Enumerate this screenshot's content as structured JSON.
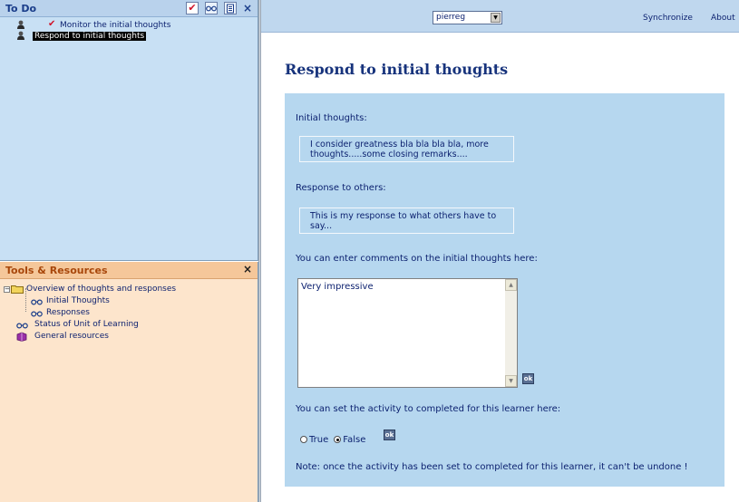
{
  "todo_panel": {
    "title": "To Do",
    "close_label": "×",
    "items": [
      {
        "label": "Monitor the initial thoughts",
        "done": true
      },
      {
        "label": "Respond to initial thoughts",
        "selected": true
      }
    ]
  },
  "tools_panel": {
    "title": "Tools & Resources",
    "close_label": "×",
    "expander_label": "−",
    "tree": [
      {
        "label": "Overview of thoughts and responses",
        "icon": "folder-icon"
      },
      {
        "label": "Initial Thoughts",
        "icon": "glasses-icon"
      },
      {
        "label": "Responses",
        "icon": "glasses-icon"
      },
      {
        "label": "Status of Unit of Learning",
        "icon": "glasses-icon"
      },
      {
        "label": "General resources",
        "icon": "book-icon"
      }
    ]
  },
  "topbar": {
    "user_select_value": "pierreg",
    "synchronize_label": "Synchronize",
    "about_label": "About"
  },
  "activity": {
    "title": "Respond to initial thoughts",
    "initial_thoughts_label": "Initial thoughts:",
    "initial_thoughts_text": "I consider greatness bla bla bla bla, more thoughts.....some closing remarks....",
    "response_label": "Response to others:",
    "response_text": "This is my response to what others have to say...",
    "comment_label": "You can enter comments on the initial thoughts here:",
    "comment_value": "Very impressive",
    "ok_label": "ok",
    "completed_label": "You can set the activity to completed for this learner here:",
    "true_label": "True",
    "false_label": "False",
    "selected_option": "False",
    "note": "Note: once the activity has been set to completed for this learner, it can't be undone !"
  },
  "colors": {
    "todo_bg": "#c8e0f4",
    "tools_bg": "#fde5cc",
    "activity_bg": "#b6d7ef",
    "title_text": "#17337c"
  }
}
